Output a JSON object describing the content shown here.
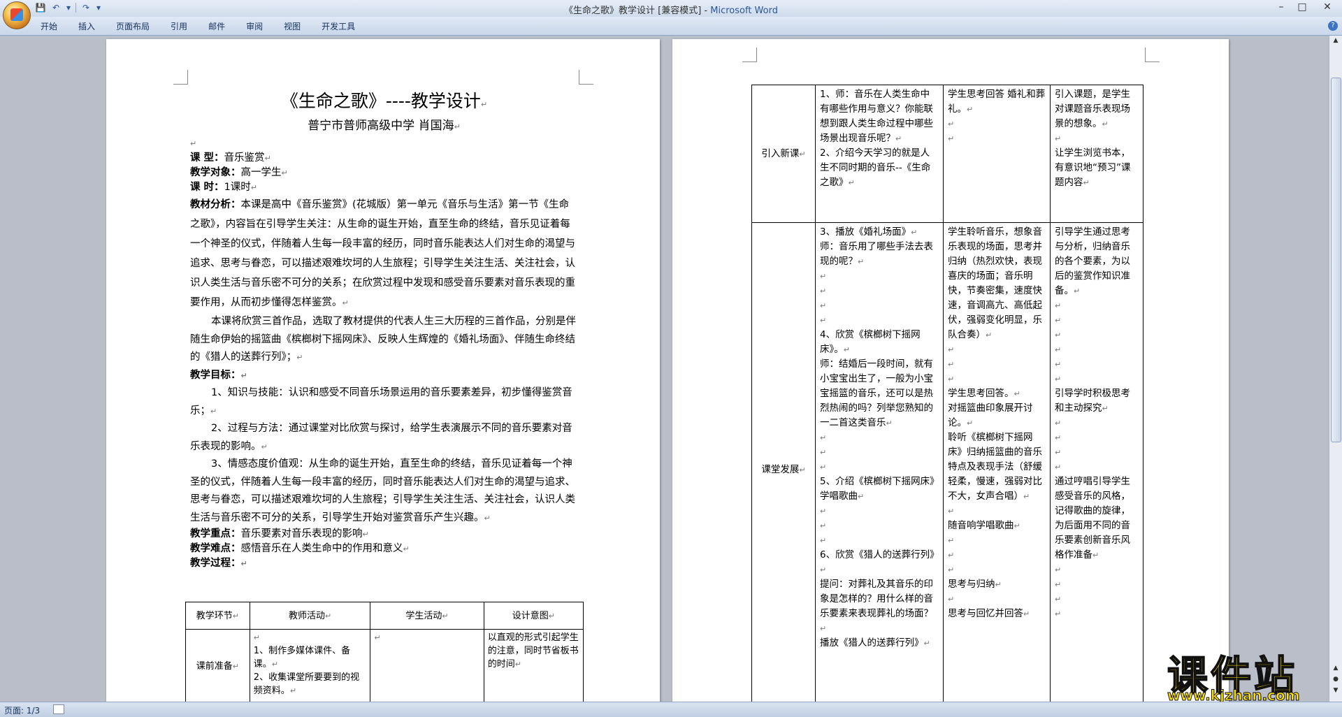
{
  "window": {
    "title_doc": "《生命之歌》教学设计 [兼容模式] - ",
    "title_app": "Microsoft Word"
  },
  "quick_access": {
    "save_icon": "save-icon",
    "undo_icon": "undo-icon",
    "redo_icon": "redo-icon",
    "customize_icon": "dropdown-icon"
  },
  "ribbon_tabs": [
    "开始",
    "插入",
    "页面布局",
    "引用",
    "邮件",
    "审阅",
    "视图",
    "开发工具"
  ],
  "status_bar": {
    "page": "页面: 1/3"
  },
  "page1": {
    "title": "《生命之歌》----教学设计",
    "subtitle": "普宁市普师高级中学    肖国海",
    "course_type_label": "课    型：",
    "course_type_value": "音乐鉴赏",
    "audience_label": "教学对象：",
    "audience_value": "高一学生",
    "hours_label": "课    时：",
    "hours_value": "1课时",
    "analysis_label": "教材分析：",
    "analysis_text": "本课是高中《音乐鉴赏》(花城版）第一单元《音乐与生活》第一节《生命之歌》，内容旨在引导学生关注：从生命的诞生开始，直至生命的终结，音乐见证着每一个神圣的仪式，伴随着人生每一段丰富的经历，同时音乐能表达人们对生命的渴望与追求、思考与眷恋，可以描述艰难坎坷的人生旅程；引导学生关注生活、关注社会，认识人类生活与音乐密不可分的关系；在欣赏过程中发现和感受音乐要素对音乐表现的重要作用，从而初步懂得怎样鉴赏。",
    "works_text": "本课将欣赏三首作品，选取了教材提供的代表人生三大历程的三首作品，分别是伴随生命伊始的摇篮曲《槟榔树下摇网床》、反映人生辉煌的《婚礼场面》、伴随生命终结的《猎人的送葬行列》；",
    "goals_label": "教学目标：",
    "goal1": "1、知识与技能：认识和感受不同音乐场景运用的音乐要素差异，初步懂得鉴赏音乐；",
    "goal2": "2、过程与方法：通过课堂对比欣赏与探讨，给学生表演展示不同的音乐要素对音乐表现的影响。",
    "goal3": "3、情感态度价值观：从生命的诞生开始，直至生命的终结，音乐见证着每一个神圣的仪式，伴随着人生每一段丰富的经历，同时音乐能表达人们对生命的渴望与追求、思考与眷恋，可以描述艰难坎坷的人生旅程；引导学生关注生活、关注社会，认识人类生活与音乐密不可分的关系，引导学生开始对鉴赏音乐产生兴趣。",
    "key_label": "教学重点：",
    "key_value": "音乐要素对音乐表现的影响",
    "difficulty_label": "教学难点：",
    "difficulty_value": "感悟音乐在人类生命中的作用和意义",
    "process_label": "教学过程：",
    "table_headers": [
      "教学环节",
      "教师活动",
      "学生活动",
      "设计意图"
    ],
    "row1": {
      "stage": "课前准备",
      "teacher": [
        "1、制作多媒体课件、备课。",
        "2、收集课堂所要要到的视频资料。"
      ],
      "student": "",
      "intent": "以直观的形式引起学生的注意，同时节省板书的时间"
    }
  },
  "page2": {
    "rows": [
      {
        "stage": "引入新课",
        "teacher": [
          "1、师：音乐在人类生命中有哪些作用与意义？你能联想到跟人类生命过程中哪些场景出现音乐呢？",
          "2、介绍今天学习的就是人生不同时期的音乐--《生命之歌》"
        ],
        "student": [
          "学生思考回答  婚礼和葬礼。"
        ],
        "intent": [
          "引入课题，是学生对课题音乐表现场景的想象。",
          "让学生浏览书本，有意识地“预习”课题内容"
        ]
      },
      {
        "stage": "课堂发展",
        "teacher": [
          "3、播放《婚礼场面》",
          "师：音乐用了哪些手法去表现的呢？",
          "4、欣赏《槟榔树下摇网床》。",
          "师：结婚后一段时间，就有小宝宝出生了，一般为小宝宝摇篮的音乐，还可以是热烈热闹的吗？列举您熟知的一二首这类音乐",
          "5、介绍《槟榔树下摇网床》学唱歌曲",
          "6、欣赏《猎人的送葬行列》",
          "提问：对葬礼及其音乐的印象是怎样的？用什么样的音乐要素来表现葬礼的场面？",
          "播放《猎人的送葬行列》"
        ],
        "student": [
          "学生聆听音乐，想象音乐表现的场面，思考并归纳（热烈欢快，表现喜庆的场面；音乐明快，节奏密集，速度快速，音调高亢、高低起伏，强弱变化明显，乐队合奏）",
          "学生思考回答。",
          "对摇篮曲印象展开讨论。",
          "聆听《槟榔树下摇网床》归纳摇篮曲的音乐特点及表现手法（舒缓轻柔，慢速，强弱对比不大，女声合唱）",
          "随音响学唱歌曲",
          "思考与归纳",
          "思考与回忆并回答"
        ],
        "intent": [
          "引导学生通过思考与分析，归纳音乐的各个要素，为以后的鉴赏作知识准备。",
          "引导学时积极思考和主动探究",
          "通过哼唱引导学生感受音乐的风格，记得歌曲的旋律，为后面用不同的音乐要素创新音乐风格作准备"
        ]
      }
    ]
  },
  "watermark": {
    "brand": "课件站",
    "url": "www.kjzhan.com"
  },
  "colors": {
    "ribbon": "#dfe8f5",
    "workspace": "#b9bec8",
    "watermark": "#ffe000"
  }
}
